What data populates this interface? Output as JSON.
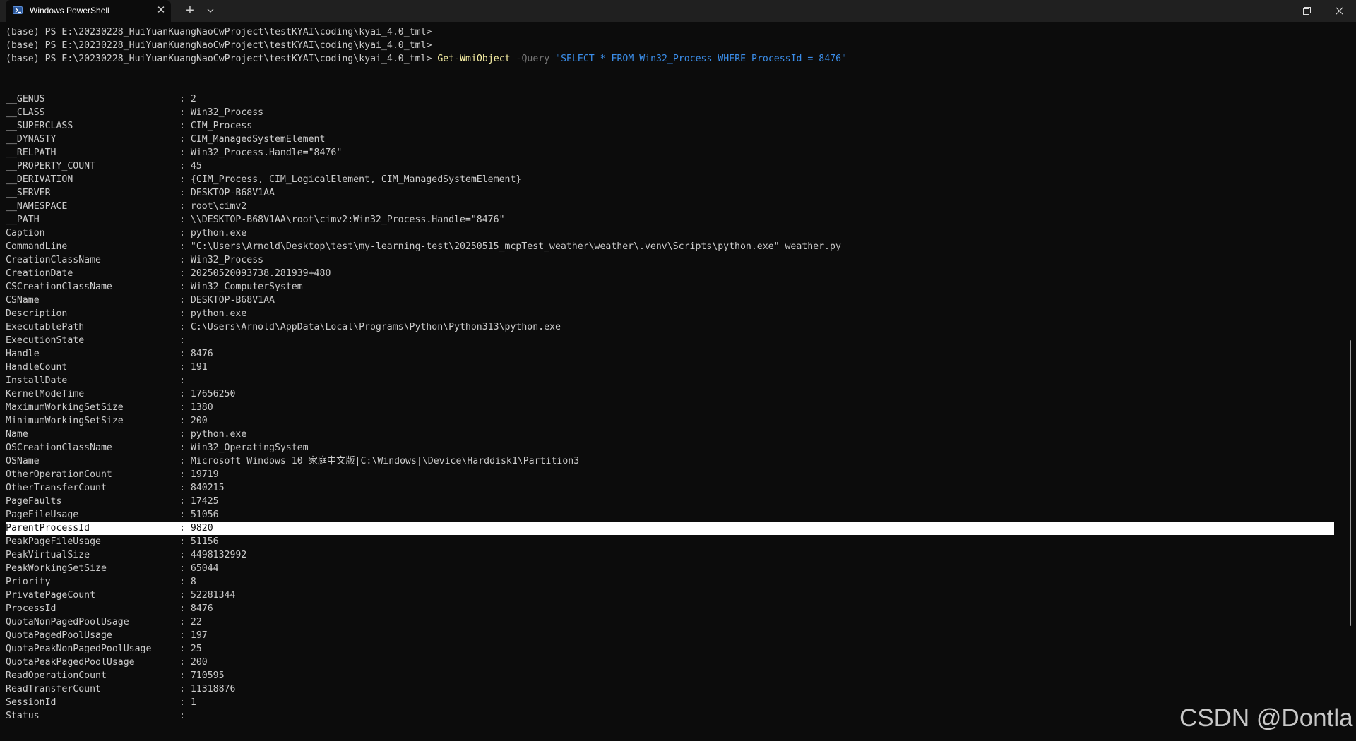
{
  "window": {
    "tab_title": "Windows PowerShell",
    "tab_close_glyph": "✕",
    "new_tab_glyph": "+",
    "icons": {
      "tab": "powershell-icon",
      "dropdown": "chevron-down-icon",
      "minimize": "minimize-icon",
      "maximize": "restore-icon",
      "close": "close-icon"
    }
  },
  "terminal": {
    "prompts": [
      "(base) PS E:\\20230228_HuiYuanKuangNaoCwProject\\testKYAI\\coding\\kyai_4.0_tml>",
      "(base) PS E:\\20230228_HuiYuanKuangNaoCwProject\\testKYAI\\coding\\kyai_4.0_tml>"
    ],
    "command": {
      "prompt": "(base) PS E:\\20230228_HuiYuanKuangNaoCwProject\\testKYAI\\coding\\kyai_4.0_tml> ",
      "cmdlet": "Get-WmiObject",
      "parameter": "-Query",
      "argument": "\"SELECT * FROM Win32_Process WHERE ProcessId = 8476\""
    },
    "separator": ": ",
    "selected_property": "ParentProcessId",
    "properties": [
      {
        "key": "__GENUS",
        "value": "2"
      },
      {
        "key": "__CLASS",
        "value": "Win32_Process"
      },
      {
        "key": "__SUPERCLASS",
        "value": "CIM_Process"
      },
      {
        "key": "__DYNASTY",
        "value": "CIM_ManagedSystemElement"
      },
      {
        "key": "__RELPATH",
        "value": "Win32_Process.Handle=\"8476\""
      },
      {
        "key": "__PROPERTY_COUNT",
        "value": "45"
      },
      {
        "key": "__DERIVATION",
        "value": "{CIM_Process, CIM_LogicalElement, CIM_ManagedSystemElement}"
      },
      {
        "key": "__SERVER",
        "value": "DESKTOP-B68V1AA"
      },
      {
        "key": "__NAMESPACE",
        "value": "root\\cimv2"
      },
      {
        "key": "__PATH",
        "value": "\\\\DESKTOP-B68V1AA\\root\\cimv2:Win32_Process.Handle=\"8476\""
      },
      {
        "key": "Caption",
        "value": "python.exe"
      },
      {
        "key": "CommandLine",
        "value": "\"C:\\Users\\Arnold\\Desktop\\test\\my-learning-test\\20250515_mcpTest_weather\\weather\\.venv\\Scripts\\python.exe\" weather.py"
      },
      {
        "key": "CreationClassName",
        "value": "Win32_Process"
      },
      {
        "key": "CreationDate",
        "value": "20250520093738.281939+480"
      },
      {
        "key": "CSCreationClassName",
        "value": "Win32_ComputerSystem"
      },
      {
        "key": "CSName",
        "value": "DESKTOP-B68V1AA"
      },
      {
        "key": "Description",
        "value": "python.exe"
      },
      {
        "key": "ExecutablePath",
        "value": "C:\\Users\\Arnold\\AppData\\Local\\Programs\\Python\\Python313\\python.exe"
      },
      {
        "key": "ExecutionState",
        "value": ""
      },
      {
        "key": "Handle",
        "value": "8476"
      },
      {
        "key": "HandleCount",
        "value": "191"
      },
      {
        "key": "InstallDate",
        "value": ""
      },
      {
        "key": "KernelModeTime",
        "value": "17656250"
      },
      {
        "key": "MaximumWorkingSetSize",
        "value": "1380"
      },
      {
        "key": "MinimumWorkingSetSize",
        "value": "200"
      },
      {
        "key": "Name",
        "value": "python.exe"
      },
      {
        "key": "OSCreationClassName",
        "value": "Win32_OperatingSystem"
      },
      {
        "key": "OSName",
        "value": "Microsoft Windows 10 家庭中文版|C:\\Windows|\\Device\\Harddisk1\\Partition3"
      },
      {
        "key": "OtherOperationCount",
        "value": "19719"
      },
      {
        "key": "OtherTransferCount",
        "value": "840215"
      },
      {
        "key": "PageFaults",
        "value": "17425"
      },
      {
        "key": "PageFileUsage",
        "value": "51056"
      },
      {
        "key": "ParentProcessId",
        "value": "9820"
      },
      {
        "key": "PeakPageFileUsage",
        "value": "51156"
      },
      {
        "key": "PeakVirtualSize",
        "value": "4498132992"
      },
      {
        "key": "PeakWorkingSetSize",
        "value": "65044"
      },
      {
        "key": "Priority",
        "value": "8"
      },
      {
        "key": "PrivatePageCount",
        "value": "52281344"
      },
      {
        "key": "ProcessId",
        "value": "8476"
      },
      {
        "key": "QuotaNonPagedPoolUsage",
        "value": "22"
      },
      {
        "key": "QuotaPagedPoolUsage",
        "value": "197"
      },
      {
        "key": "QuotaPeakNonPagedPoolUsage",
        "value": "25"
      },
      {
        "key": "QuotaPeakPagedPoolUsage",
        "value": "200"
      },
      {
        "key": "ReadOperationCount",
        "value": "710595"
      },
      {
        "key": "ReadTransferCount",
        "value": "11318876"
      },
      {
        "key": "SessionId",
        "value": "1"
      },
      {
        "key": "Status",
        "value": ""
      }
    ]
  },
  "watermark": "CSDN @Dontla",
  "colors": {
    "background": "#0c0c0c",
    "tabbar": "#202020",
    "text": "#cccccc",
    "cmdlet": "#f9f1a5",
    "parameter": "#767676",
    "string": "#3b8eea",
    "selection": "#ffffff"
  }
}
